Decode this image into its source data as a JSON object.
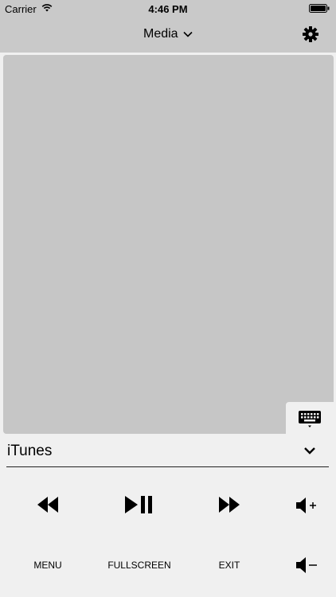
{
  "status_bar": {
    "carrier": "Carrier",
    "time": "4:46 PM",
    "wifi_icon": "wifi-icon",
    "battery_icon": "battery-icon"
  },
  "nav": {
    "title": "Media",
    "title_icon": "chevron-down-icon",
    "settings_icon": "gear-icon"
  },
  "trackpad": {
    "color": "#c6c6c6",
    "keyboard_icon": "keyboard-icon"
  },
  "app_selector": {
    "selected": "iTunes",
    "icon": "chevron-down-icon"
  },
  "controls": {
    "rewind_icon": "rewind-icon",
    "play_pause_icon": "play-pause-icon",
    "forward_icon": "fast-forward-icon",
    "volume_up_icon": "volume-up-icon",
    "volume_down_icon": "volume-down-icon",
    "menu_label": "MENU",
    "fullscreen_label": "FULLSCREEN",
    "exit_label": "EXIT"
  },
  "colors": {
    "bar_background": "#c9c9c9",
    "page_background": "#f0f0f0",
    "trackpad": "#c6c6c6"
  }
}
